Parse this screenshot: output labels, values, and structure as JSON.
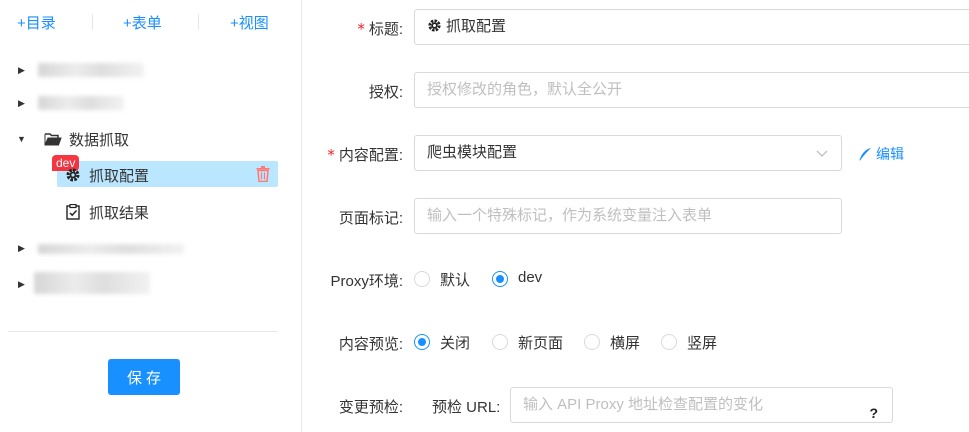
{
  "sidebar": {
    "links": {
      "catalog": "+目录",
      "form": "+表单",
      "view": "+视图"
    },
    "folder_label": "数据抓取",
    "selected_item_label": "抓取配置",
    "selected_item_badge": "dev",
    "second_item_label": "抓取结果",
    "save_label": "保存"
  },
  "form": {
    "title": {
      "label": "标题:",
      "required_mark": "*",
      "value": "抓取配置"
    },
    "auth": {
      "label": "授权:",
      "placeholder": "授权修改的角色，默认全公开"
    },
    "content_config": {
      "label": "内容配置:",
      "required_mark": "*",
      "value": "爬虫模块配置",
      "edit_label": "编辑"
    },
    "page_tag": {
      "label": "页面标记:",
      "placeholder": "输入一个特殊标记，作为系统变量注入表单"
    },
    "proxy_env": {
      "label": "Proxy环境:",
      "options": [
        "默认",
        "dev"
      ],
      "selected": "dev"
    },
    "preview": {
      "label": "内容预览:",
      "options": [
        "关闭",
        "新页面",
        "横屏",
        "竖屏"
      ],
      "selected": "关闭"
    },
    "change_check": {
      "label": "变更预检:",
      "sub_label": "预检 URL:",
      "placeholder": "输入 API Proxy 地址检查配置的变化",
      "help": "?"
    }
  },
  "colors": {
    "primary": "#1890ff",
    "selected_bg": "#bae7ff",
    "danger": "#f5222d"
  }
}
